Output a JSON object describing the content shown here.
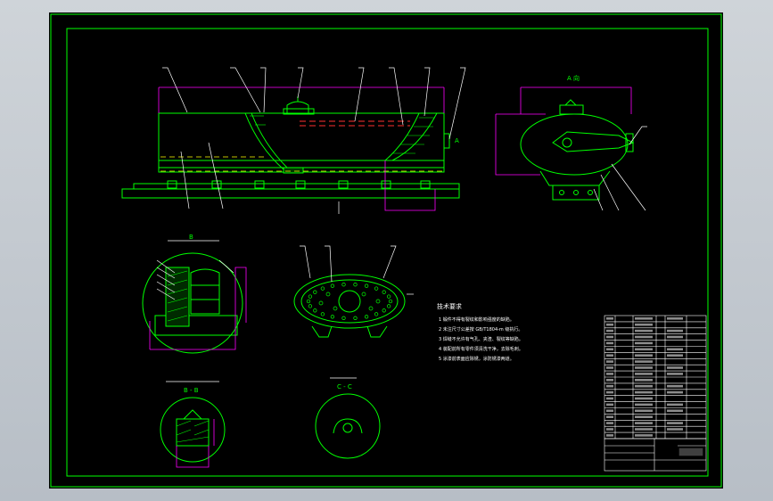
{
  "colors": {
    "background": "#000000",
    "frame": "#00ff00",
    "outline": "#00ff00",
    "dimension": "#ff00ff",
    "leader": "#ffffff",
    "hidden_line": "#ffff00",
    "cut_line": "#ff3030",
    "hatch": "#00ff00",
    "viewport": "#c9ced4"
  },
  "icons": {
    "drawing_canvas": "cad-drawing",
    "title_block": "table-grid"
  },
  "labels": {
    "view_a_top": "A",
    "view_a_side": "A",
    "view_b": "B",
    "view_c": "C",
    "section_b": "B - B",
    "section_c": "C - C",
    "view_detail": "A 向",
    "tech_title": "技术要求"
  },
  "technical_notes": [
    "1  锻件不得有裂纹和影响强度的缺陷。",
    "2  未注尺寸公差按 GB/T1804-m 级执行。",
    "3  焊缝不允许有气孔、夹渣、裂纹等缺陷。",
    "4  装配前所有零件须清洗干净，去除毛刺。",
    "5  涂漆前表面应除锈，涂防锈漆两道。"
  ]
}
